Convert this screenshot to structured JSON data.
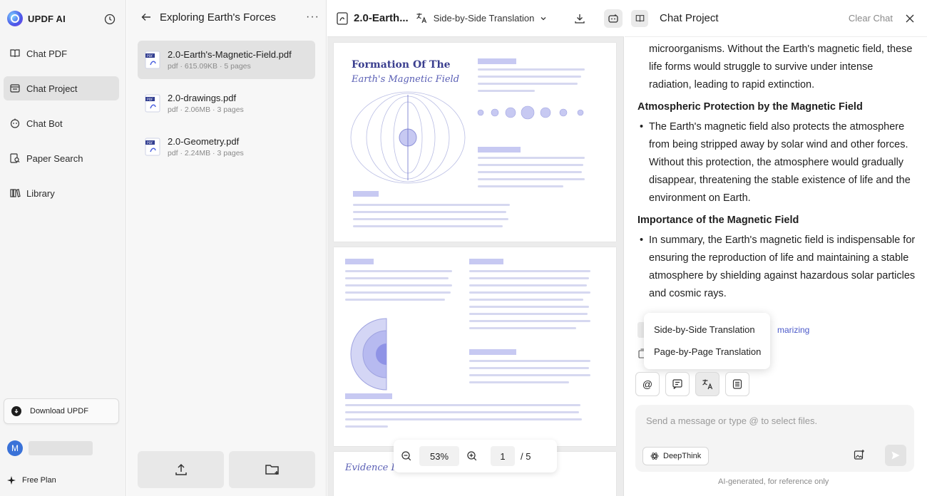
{
  "sidebar": {
    "brand": "UPDF AI",
    "nav": [
      {
        "label": "Chat PDF",
        "icon": "book-open-icon"
      },
      {
        "label": "Chat Project",
        "icon": "folder-chat-icon"
      },
      {
        "label": "Chat Bot",
        "icon": "bot-icon"
      },
      {
        "label": "Paper Search",
        "icon": "search-doc-icon"
      },
      {
        "label": "Library",
        "icon": "library-icon"
      }
    ],
    "download_label": "Download UPDF",
    "avatar_letter": "M",
    "plan": "Free Plan"
  },
  "file_panel": {
    "title": "Exploring Earth's Forces",
    "more": "···",
    "files": [
      {
        "name": "2.0-Earth's-Magnetic-Field.pdf",
        "meta": "pdf · 615.09KB · 5 pages"
      },
      {
        "name": "2.0-drawings.pdf",
        "meta": "pdf · 2.06MB · 3 pages"
      },
      {
        "name": "2.0-Geometry.pdf",
        "meta": "pdf · 2.24MB · 3 pages"
      }
    ]
  },
  "viewer": {
    "doc_name": "2.0-Earth...",
    "mode": "Side-by-Side Translation",
    "page1_title_line1": "Formation Of The",
    "page1_title_line2": "Earth's Magnetic Field",
    "page3_title": "Evidence Fo",
    "zoom": "53%",
    "page_current": "1",
    "page_total": "/ 5"
  },
  "chat": {
    "title": "Chat Project",
    "clear_label": "Clear Chat",
    "para1": "microorganisms. Without the Earth's magnetic field, these life forms would struggle to survive under intense radiation, leading to rapid extinction.",
    "heading1": "Atmospheric Protection by the Magnetic Field",
    "bullet1": "The Earth's magnetic field also protects the atmosphere from being stripped away by solar wind and other forces. Without this protection, the atmosphere would gradually disappear, threatening the stable existence of life and the environment on Earth.",
    "heading2": "Importance of the Magnetic Field",
    "bullet2": "In summary, the Earth's magnetic field is indispensable for ensuring the reproduction of life and maintaining a stable atmosphere by shielding against hazardous solar particles and cosmic rays.",
    "partial_link": "marizing",
    "dropdown": [
      "Side-by-Side Translation",
      "Page-by-Page Translation"
    ],
    "tools": [
      "@"
    ],
    "input_placeholder": "Send a message or type @ to select files.",
    "deepthink_label": "DeepThink",
    "ai_note": "AI-generated, for reference only"
  }
}
